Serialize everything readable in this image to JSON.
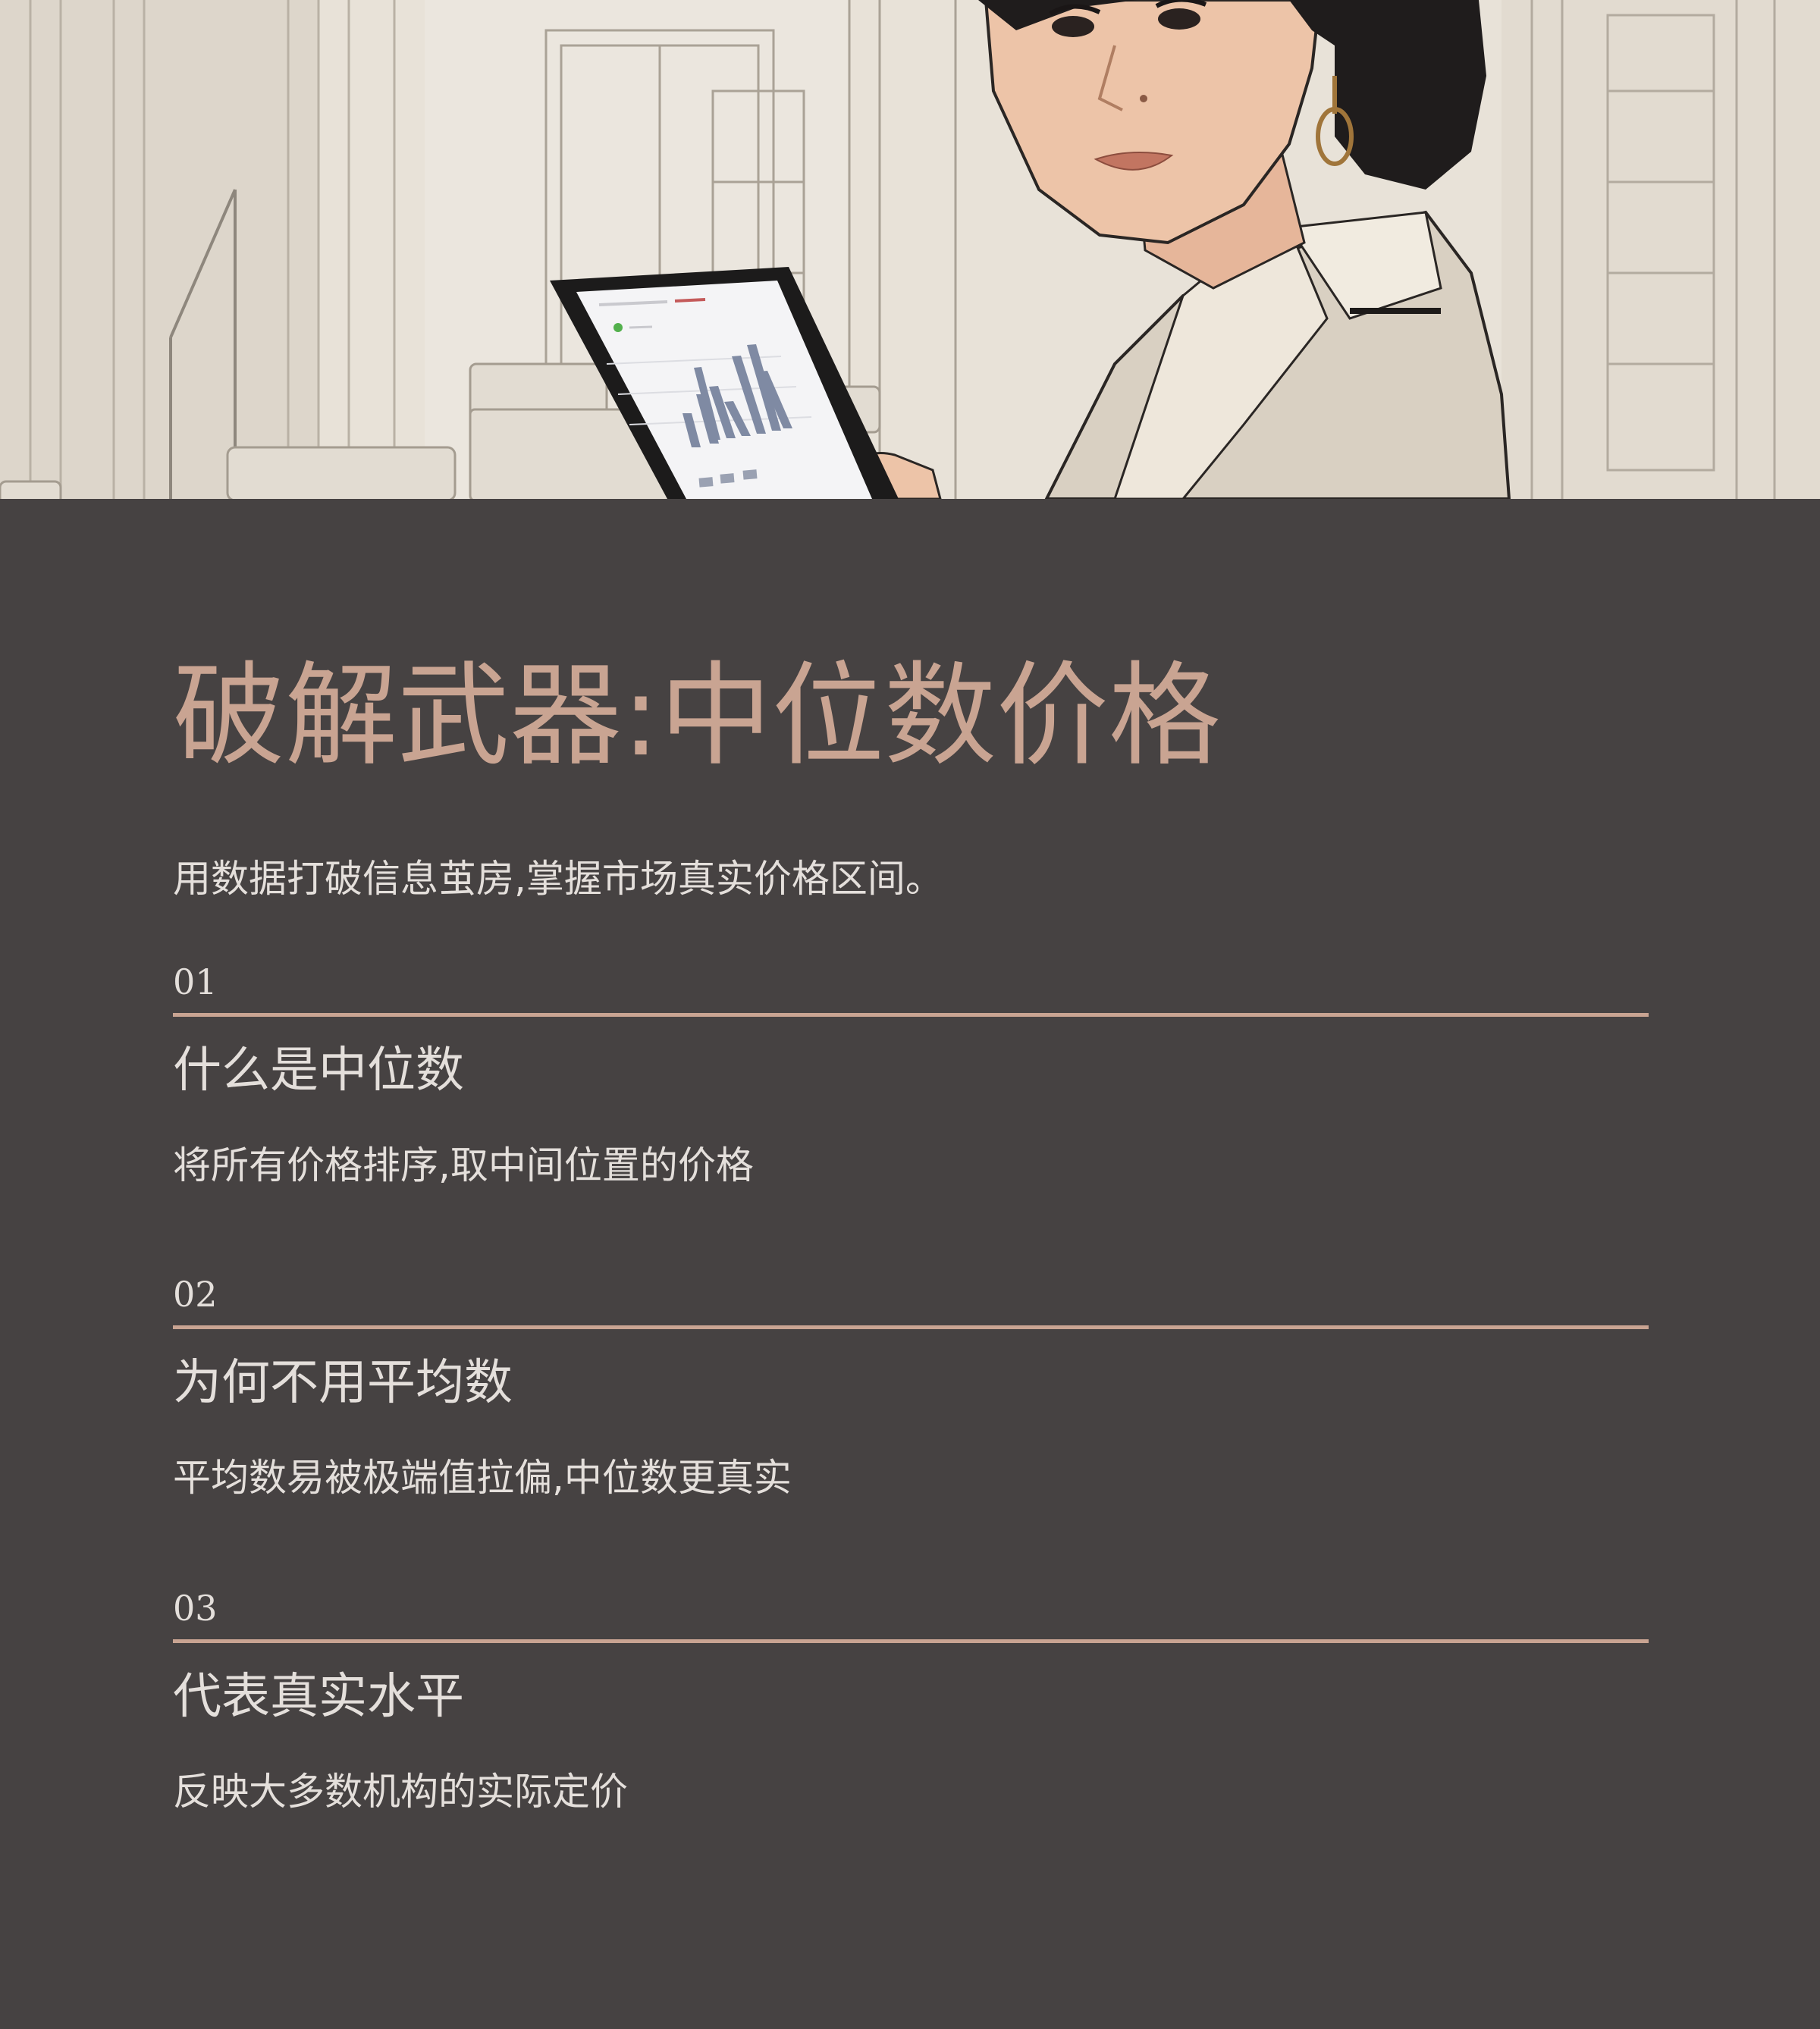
{
  "hero": {
    "image_icon": "woman-with-tablet-illustration"
  },
  "colors": {
    "background": "#464242",
    "accent": "#c9a492",
    "text": "#e4dfdb"
  },
  "title": "破解武器:中位数价格",
  "subtitle": "用数据打破信息茧房,掌握市场真实价格区间。",
  "items": [
    {
      "number": "01",
      "heading": "什么是中位数",
      "description": "将所有价格排序,取中间位置的价格"
    },
    {
      "number": "02",
      "heading": "为何不用平均数",
      "description": "平均数易被极端值拉偏,中位数更真实"
    },
    {
      "number": "03",
      "heading": "代表真实水平",
      "description": "反映大多数机构的实际定价"
    }
  ]
}
